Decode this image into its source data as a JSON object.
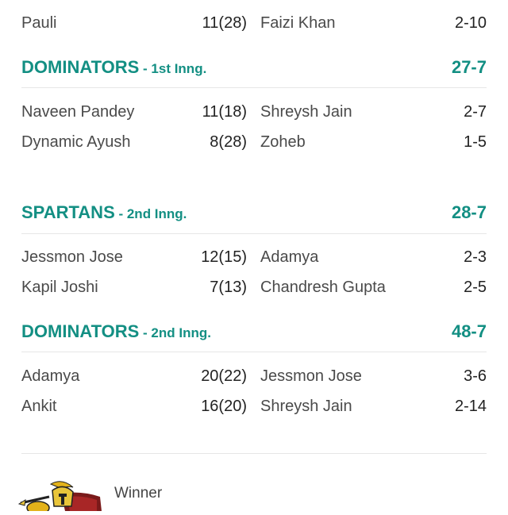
{
  "partial_row": {
    "batter": "Pauli",
    "bat_score": "11(28)",
    "bowler": "Faizi Khan",
    "bowl_fig": "2-10"
  },
  "innings": [
    {
      "team": "DOMINATORS",
      "label": " - 1st Inng.",
      "total": "27-7",
      "rows": [
        {
          "batter": "Naveen Pandey",
          "bat_score": "11(18)",
          "bowler": "Shreysh Jain",
          "bowl_fig": "2-7"
        },
        {
          "batter": "Dynamic Ayush",
          "bat_score": "8(28)",
          "bowler": "Zoheb",
          "bowl_fig": "1-5"
        }
      ]
    },
    {
      "team": "SPARTANS",
      "label": " - 2nd Inng.",
      "total": "28-7",
      "rows": [
        {
          "batter": "Jessmon Jose",
          "bat_score": "12(15)",
          "bowler": "Adamya",
          "bowl_fig": "2-3"
        },
        {
          "batter": "Kapil Joshi",
          "bat_score": "7(13)",
          "bowler": "Chandresh Gupta",
          "bowl_fig": "2-5"
        }
      ]
    },
    {
      "team": "DOMINATORS",
      "label": " - 2nd Inng.",
      "total": "48-7",
      "rows": [
        {
          "batter": "Adamya",
          "bat_score": "20(22)",
          "bowler": "Jessmon Jose",
          "bowl_fig": "3-6"
        },
        {
          "batter": "Ankit",
          "bat_score": "16(20)",
          "bowler": "Shreysh Jain",
          "bowl_fig": "2-14"
        }
      ]
    }
  ],
  "winner": {
    "label": "Winner",
    "logo_icon": "spartan-warrior-logo-icon"
  },
  "colors": {
    "accent": "#138f83",
    "divider": "#e6e6e6"
  }
}
